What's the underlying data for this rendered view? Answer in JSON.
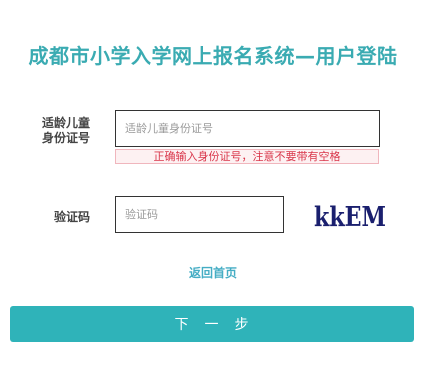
{
  "title": "成都市小学入学网上报名系统—用户登陆",
  "form": {
    "id_label_line1": "适龄儿童",
    "id_label_line2": "身份证号",
    "id_placeholder": "适龄儿童身份证号",
    "id_hint": "正确输入身份证号，注意不要带有空格",
    "code_label": "验证码",
    "code_placeholder": "验证码",
    "captcha_text": "kkEM"
  },
  "links": {
    "back_home": "返回首页"
  },
  "buttons": {
    "next": "下　一　步"
  },
  "colors": {
    "accent": "#3aabb2",
    "button": "#2fb3b9",
    "error_text": "#d9364a",
    "error_bg": "#fdf1f2",
    "captcha_ink": "#1a1f6e"
  }
}
